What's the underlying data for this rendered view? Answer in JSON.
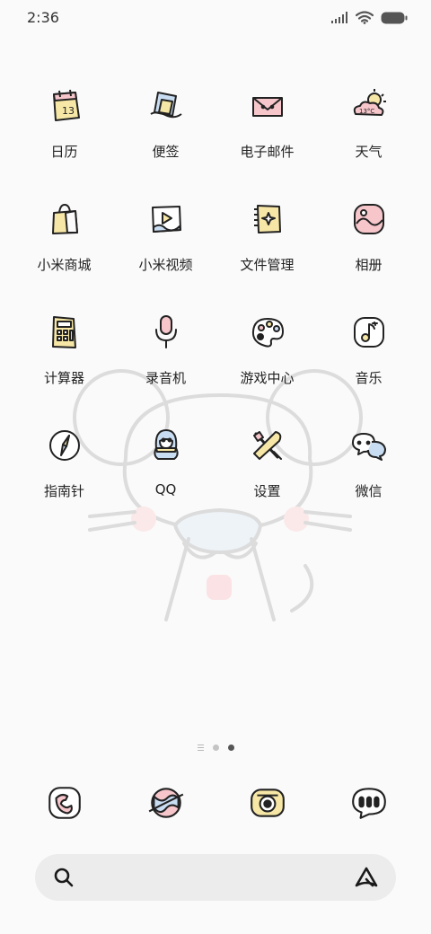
{
  "status_bar": {
    "time": "2:36",
    "icons": [
      "signal-icon",
      "wifi-icon",
      "battery-icon"
    ]
  },
  "home": {
    "rows": [
      [
        {
          "label": "日历",
          "icon": "calendar-icon"
        },
        {
          "label": "便签",
          "icon": "notes-icon"
        },
        {
          "label": "电子邮件",
          "icon": "email-icon"
        },
        {
          "label": "天气",
          "icon": "weather-icon"
        }
      ],
      [
        {
          "label": "小米商城",
          "icon": "shop-bag-icon"
        },
        {
          "label": "小米视频",
          "icon": "video-icon"
        },
        {
          "label": "文件管理",
          "icon": "folder-icon"
        },
        {
          "label": "相册",
          "icon": "gallery-icon"
        }
      ],
      [
        {
          "label": "计算器",
          "icon": "calculator-icon"
        },
        {
          "label": "录音机",
          "icon": "microphone-icon"
        },
        {
          "label": "游戏中心",
          "icon": "palette-icon"
        },
        {
          "label": "音乐",
          "icon": "music-icon"
        }
      ],
      [
        {
          "label": "指南针",
          "icon": "compass-icon"
        },
        {
          "label": "QQ",
          "icon": "penguin-icon"
        },
        {
          "label": "设置",
          "icon": "tools-icon"
        },
        {
          "label": "微信",
          "icon": "chat-bubbles-icon"
        }
      ]
    ],
    "weather_icon_text": "13°C",
    "calendar_icon_text": "13"
  },
  "page_indicator": {
    "pages": 3,
    "current": 3
  },
  "dock": [
    {
      "icon": "phone-icon"
    },
    {
      "icon": "browser-planet-icon"
    },
    {
      "icon": "camera-icon"
    },
    {
      "icon": "messages-icon"
    }
  ],
  "search_bar": {
    "left_icon": "search-icon",
    "right_icon": "assistant-icon"
  },
  "colors": {
    "background": "#fafafa",
    "search_bar": "#ececec",
    "icon_stroke": "#222222",
    "accent_pink": "#f6c6cb",
    "accent_yellow": "#f7e7a6",
    "accent_blue": "#c9ddf2"
  }
}
